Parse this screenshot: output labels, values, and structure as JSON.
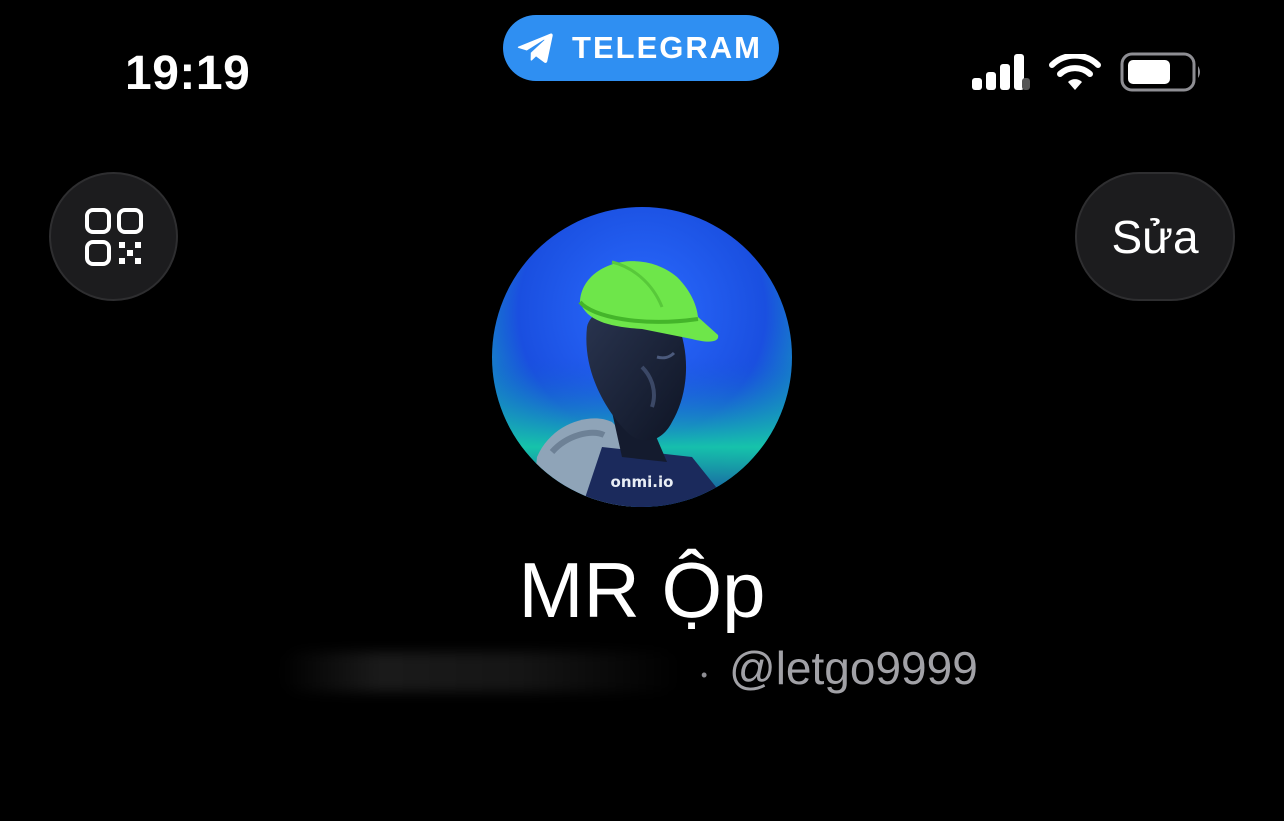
{
  "status_bar": {
    "time": "19:19",
    "app_indicator": "TELEGRAM",
    "app_indicator_icon": "telegram-plane-icon",
    "accent_color": "#2f8ff2"
  },
  "header": {
    "qr_icon": "qr-code-icon",
    "edit_label": "Sửa"
  },
  "profile": {
    "avatar_watermark": "onmi.io",
    "name": "MR Ộp",
    "username": "@letgo9999"
  }
}
